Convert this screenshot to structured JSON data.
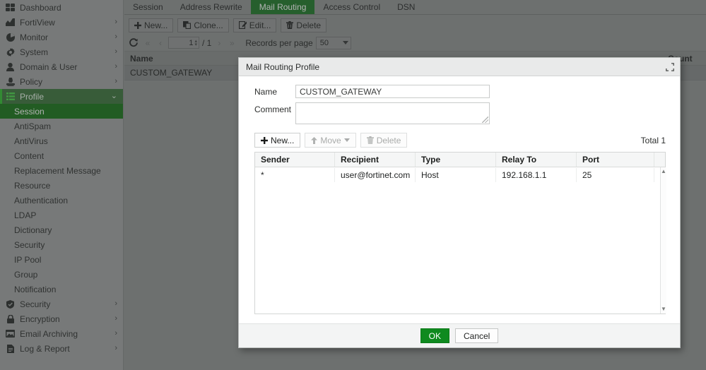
{
  "sidebar": {
    "items": [
      {
        "label": "Dashboard",
        "icon": "dashboard-icon",
        "chevron": ""
      },
      {
        "label": "FortiView",
        "icon": "fortiview-icon",
        "chevron": "›"
      },
      {
        "label": "Monitor",
        "icon": "monitor-icon",
        "chevron": "›"
      },
      {
        "label": "System",
        "icon": "gear-icon",
        "chevron": "›"
      },
      {
        "label": "Domain & User",
        "icon": "user-icon",
        "chevron": "›"
      },
      {
        "label": "Policy",
        "icon": "policy-icon",
        "chevron": "›"
      },
      {
        "label": "Profile",
        "icon": "profile-icon",
        "chevron": "⌄"
      }
    ],
    "profile_children": [
      {
        "label": "Session",
        "active": true
      },
      {
        "label": "AntiSpam",
        "active": false
      },
      {
        "label": "AntiVirus",
        "active": false
      },
      {
        "label": "Content",
        "active": false
      },
      {
        "label": "Replacement Message",
        "active": false
      },
      {
        "label": "Resource",
        "active": false
      },
      {
        "label": "Authentication",
        "active": false
      },
      {
        "label": "LDAP",
        "active": false
      },
      {
        "label": "Dictionary",
        "active": false
      },
      {
        "label": "Security",
        "active": false
      },
      {
        "label": "IP Pool",
        "active": false
      },
      {
        "label": "Group",
        "active": false
      },
      {
        "label": "Notification",
        "active": false
      }
    ],
    "items_after": [
      {
        "label": "Security",
        "icon": "shield-icon",
        "chevron": "›"
      },
      {
        "label": "Encryption",
        "icon": "lock-icon",
        "chevron": "›"
      },
      {
        "label": "Email Archiving",
        "icon": "archive-icon",
        "chevron": "›"
      },
      {
        "label": "Log & Report",
        "icon": "report-icon",
        "chevron": "›"
      }
    ]
  },
  "tabs": [
    {
      "label": "Session",
      "active": false
    },
    {
      "label": "Address Rewrite",
      "active": false
    },
    {
      "label": "Mail Routing",
      "active": true
    },
    {
      "label": "Access Control",
      "active": false
    },
    {
      "label": "DSN",
      "active": false
    }
  ],
  "toolbar": {
    "new_label": "New...",
    "clone_label": "Clone...",
    "edit_label": "Edit...",
    "delete_label": "Delete"
  },
  "pagination": {
    "refresh_icon": "refresh-icon",
    "first_icon": "«",
    "prev_icon": "‹",
    "page_value": "1",
    "page_separator": "/ 1",
    "next_icon": "›",
    "last_icon": "»",
    "records_label": "Records per page",
    "records_value": "50"
  },
  "list": {
    "columns": [
      "Name",
      "Count"
    ],
    "rows": [
      {
        "name": "CUSTOM_GATEWAY",
        "count": ""
      }
    ]
  },
  "dialog": {
    "title": "Mail Routing Profile",
    "expand_icon": "expand-icon",
    "name_label": "Name",
    "name_value": "CUSTOM_GATEWAY",
    "comment_label": "Comment",
    "comment_value": "",
    "inner_toolbar": {
      "new_label": "New...",
      "move_label": "Move",
      "delete_label": "Delete"
    },
    "total_label": "Total 1",
    "grid": {
      "columns": [
        "Sender",
        "Recipient",
        "Type",
        "Relay To",
        "Port"
      ],
      "rows": [
        {
          "sender": "*",
          "recipient": "user@fortinet.com",
          "type": "Host",
          "relay_to": "192.168.1.1",
          "port": "25"
        }
      ]
    },
    "ok_label": "OK",
    "cancel_label": "Cancel"
  },
  "colors": {
    "brand_green": "#10711a",
    "active_sub_green": "#0a6b0a",
    "ok_green": "#0f8a1f",
    "sidebar_bg": "#9b9e9d",
    "page_bg": "#8a8d8c"
  }
}
